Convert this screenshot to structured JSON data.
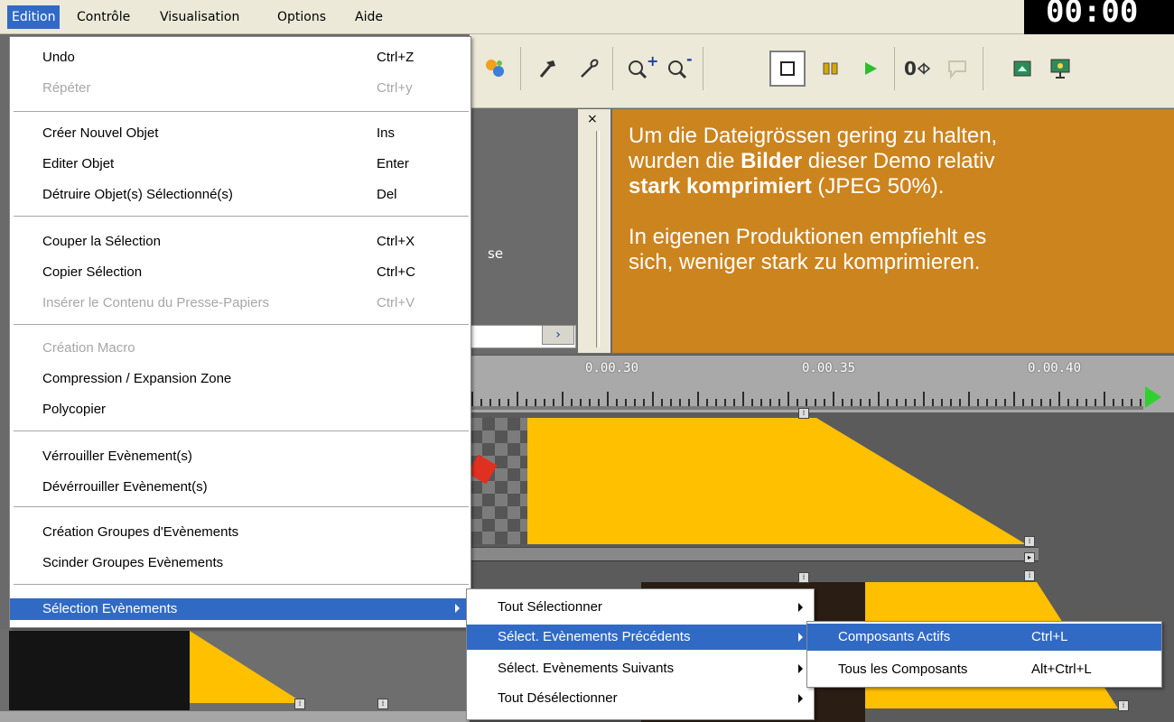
{
  "menubar": {
    "items": [
      {
        "label": "Edition",
        "active": true
      },
      {
        "label": "Contrôle"
      },
      {
        "label": "Visualisation"
      },
      {
        "label": "Options"
      },
      {
        "label": "Aide"
      }
    ],
    "clock": "00:00"
  },
  "toolbar": {
    "zoom_in_plus": "+",
    "zoom_out_minus": "-",
    "counter_label": "0"
  },
  "info_box": {
    "line1": "Um die Dateigrössen gering zu halten,",
    "line2_a": "wurden die ",
    "line2_bold": "Bilder",
    "line2_b": " dieser Demo relativ",
    "line3_bold": "stark komprimiert",
    "line3_b": " (JPEG 50%).",
    "line4": "In eigenen Produktionen empfiehlt es",
    "line5": "sich, weniger stark zu komprimieren."
  },
  "left_panel": {
    "partial_text": "se",
    "close_glyph": "×"
  },
  "timeline": {
    "labels": [
      "0.00.30",
      "0.00.35",
      "0.00.40"
    ],
    "event_colors": {
      "event": "#ffc000",
      "info": "#cc841f",
      "highlight": "#316ac5"
    }
  },
  "edition_menu": {
    "items": [
      {
        "label": "Undo",
        "shortcut": "Ctrl+Z"
      },
      {
        "label": "Répéter",
        "shortcut": "Ctrl+y",
        "disabled": true
      },
      {
        "label": "Créer Nouvel Objet",
        "shortcut": "Ins"
      },
      {
        "label": "Editer Objet",
        "shortcut": "Enter"
      },
      {
        "label": "Détruire Objet(s) Sélectionné(s)",
        "shortcut": "Del"
      },
      {
        "label": "Couper la Sélection",
        "shortcut": "Ctrl+X"
      },
      {
        "label": "Copier Sélection",
        "shortcut": "Ctrl+C"
      },
      {
        "label": "Insérer le Contenu du Presse-Papiers",
        "shortcut": "Ctrl+V",
        "disabled": true
      },
      {
        "label": "Création Macro",
        "shortcut": "",
        "disabled": true
      },
      {
        "label": "Compression / Expansion Zone",
        "shortcut": ""
      },
      {
        "label": "Polycopier",
        "shortcut": ""
      },
      {
        "label": "Vérrouiller Evènement(s)",
        "shortcut": ""
      },
      {
        "label": "Dévérrouiller Evènement(s)",
        "shortcut": ""
      },
      {
        "label": "Création Groupes d'Evènements",
        "shortcut": ""
      },
      {
        "label": "Scinder Groupes Evènements",
        "shortcut": ""
      },
      {
        "label": "Sélection Evènements",
        "shortcut": "",
        "submenu": true,
        "highlighted": true
      }
    ]
  },
  "selection_submenu": {
    "items": [
      {
        "label": "Tout Sélectionner"
      },
      {
        "label": "Sélect. Evènements Précédents",
        "highlighted": true
      },
      {
        "label": "Sélect. Evènements Suivants"
      },
      {
        "label": "Tout Désélectionner"
      }
    ]
  },
  "components_submenu": {
    "items": [
      {
        "label": "Composants Actifs",
        "shortcut": "Ctrl+L",
        "highlighted": true
      },
      {
        "label": "Tous les Composants",
        "shortcut": "Alt+Ctrl+L"
      }
    ]
  }
}
